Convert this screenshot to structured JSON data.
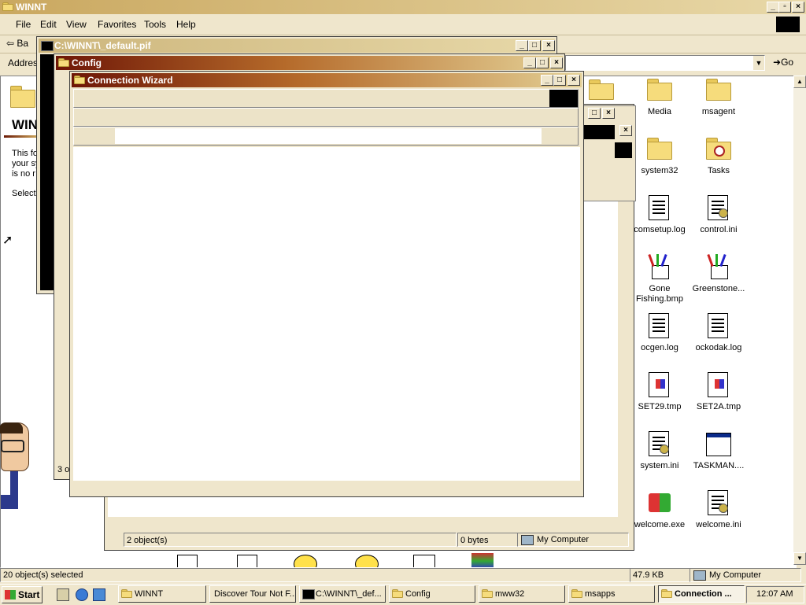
{
  "main_window": {
    "title": "WINNT",
    "menu": [
      "File",
      "Edit",
      "View",
      "Favorites",
      "Tools",
      "Help"
    ],
    "toolbar_back": "Ba",
    "address_label": "Addres",
    "go_label": "Go",
    "status_selected": "20 object(s) selected",
    "status_size": "47.9 KB",
    "status_zone": "My Computer",
    "webview_heading": "WIN",
    "webview_text": [
      "This fo",
      "your sy",
      "is no r"
    ],
    "webview_select": "Select"
  },
  "desktop_items": [
    {
      "label": "Media",
      "icon": "folder-icon"
    },
    {
      "label": "msagent",
      "icon": "folder-icon"
    },
    {
      "label": "system32",
      "icon": "folder-icon"
    },
    {
      "label": "Tasks",
      "icon": "tasks-folder-icon"
    },
    {
      "label": "comsetup.log",
      "icon": "text-document-icon"
    },
    {
      "label": "control.ini",
      "icon": "settings-document-icon"
    },
    {
      "label": "Gone Fishing.bmp",
      "icon": "paint-icon"
    },
    {
      "label": "Greenstone...",
      "icon": "paint-icon"
    },
    {
      "label": "ocgen.log",
      "icon": "text-document-icon"
    },
    {
      "label": "ockodak.log",
      "icon": "text-document-icon"
    },
    {
      "label": "SET29.tmp",
      "icon": "windows-file-icon"
    },
    {
      "label": "SET2A.tmp",
      "icon": "windows-file-icon"
    },
    {
      "label": "system.ini",
      "icon": "settings-document-icon"
    },
    {
      "label": "TASKMAN....",
      "icon": "app-window-icon"
    },
    {
      "label": "welcome.exe",
      "icon": "windows-logo-icon"
    },
    {
      "label": "welcome.ini",
      "icon": "settings-document-icon"
    }
  ],
  "pif_window": {
    "title": "C:\\WINNT\\_default.pif"
  },
  "config_window": {
    "title": "Config",
    "status_fragment": "3 o"
  },
  "wizard_window": {
    "title": "Connection Wizard"
  },
  "back_window": {
    "status_objects": "2 object(s)",
    "status_bytes": "0 bytes",
    "status_zone": "My Computer",
    "fragment": "o"
  },
  "taskbar": {
    "start_label": "Start",
    "buttons": [
      {
        "label": "WINNT",
        "icon": "folder-icon"
      },
      {
        "label": "Discover Tour Not F...",
        "icon": "none"
      },
      {
        "label": "C:\\WINNT\\_def...",
        "icon": "msdos-icon"
      },
      {
        "label": "Config",
        "icon": "folder-icon"
      },
      {
        "label": "mww32",
        "icon": "folder-icon"
      },
      {
        "label": "msapps",
        "icon": "folder-icon"
      },
      {
        "label": "Connection ...",
        "icon": "folder-icon"
      }
    ],
    "clock": "12:07 AM"
  },
  "colors": {
    "face": "#efe6cc",
    "title_active_start": "#7a1a0a",
    "title_active_end": "#d6c08a",
    "title_inactive": "#c8b37a"
  }
}
